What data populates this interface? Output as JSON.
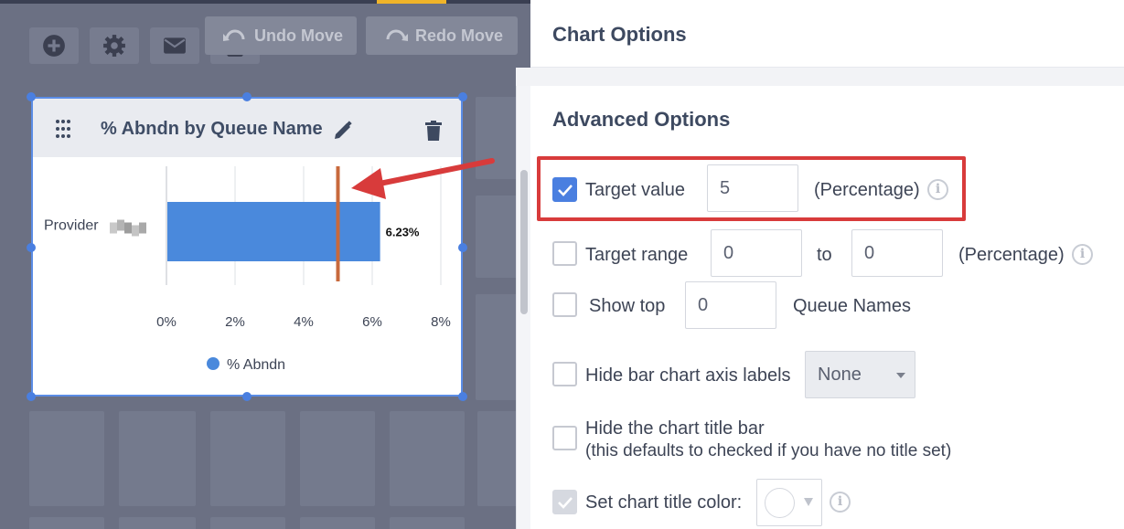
{
  "colors": {
    "accent": "#4a7fe0",
    "bar": "#4a89dc",
    "target_line": "#c8693c",
    "annotation": "#d83b3b",
    "strip_yellow": "#f0b429",
    "strip_purple": "#7b3bb0"
  },
  "toolbar": {
    "undo_label": "Undo Move",
    "redo_label": "Redo Move",
    "icons": [
      "add-icon",
      "gear-icon",
      "mail-icon",
      "lock-icon"
    ]
  },
  "widget": {
    "title": "% Abndn by Queue Name"
  },
  "chart_data": {
    "type": "bar",
    "orientation": "horizontal",
    "categories": [
      "Provider"
    ],
    "series": [
      {
        "name": "% Abndn",
        "values": [
          6.23
        ]
      }
    ],
    "data_labels": [
      "6.23%"
    ],
    "xlim": [
      0,
      8
    ],
    "x_ticks": [
      "0%",
      "2%",
      "4%",
      "6%",
      "8%"
    ],
    "target_value": 5,
    "grid": true,
    "legend": "bottom"
  },
  "panel": {
    "title": "Chart Options",
    "section_title": "Advanced Options",
    "target_value": {
      "label": "Target value",
      "value": "5",
      "unit": "(Percentage)",
      "checked": true
    },
    "target_range": {
      "label": "Target range",
      "from": "0",
      "to_label": "to",
      "to": "0",
      "unit": "(Percentage)",
      "checked": false
    },
    "show_top": {
      "label": "Show top",
      "value": "0",
      "suffix": "Queue Names",
      "checked": false
    },
    "hide_axis_labels": {
      "label": "Hide bar chart axis labels",
      "select_value": "None",
      "checked": false
    },
    "hide_title_bar": {
      "line1": "Hide the chart title bar",
      "line2": "(this defaults to checked if you have no title set)",
      "checked": false
    },
    "title_color": {
      "label": "Set chart title color:",
      "checked": true,
      "disabled": true
    }
  }
}
